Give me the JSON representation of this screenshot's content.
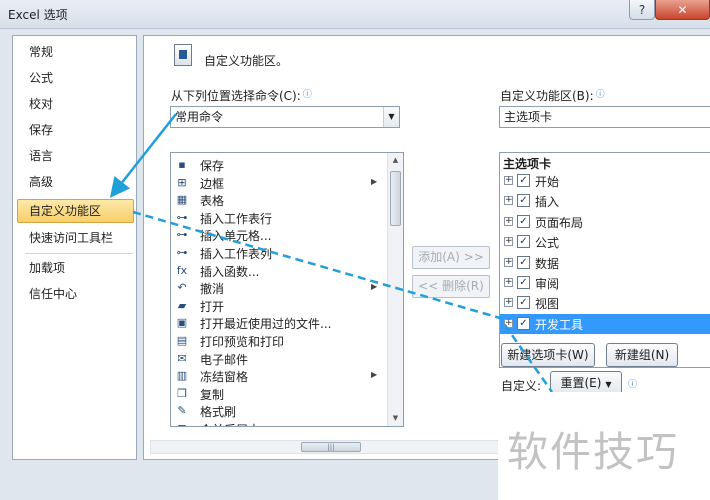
{
  "window": {
    "title": "Excel 选项",
    "help_glyph": "?",
    "close_glyph": "✕"
  },
  "nav": {
    "items": [
      {
        "label": "常规"
      },
      {
        "label": "公式"
      },
      {
        "label": "校对"
      },
      {
        "label": "保存"
      },
      {
        "label": "语言"
      },
      {
        "label": "高级"
      },
      {
        "label": "自定义功能区",
        "active": true
      },
      {
        "label": "快速访问工具栏"
      },
      {
        "label": "加载项"
      },
      {
        "label": "信任中心"
      }
    ]
  },
  "main": {
    "header": {
      "title": "自定义功能区。"
    },
    "choose_commands": {
      "label": "从下列位置选择命令(C):",
      "value": "常用命令"
    },
    "customize_ribbon": {
      "label": "自定义功能区(B):",
      "value": "主选项卡"
    },
    "commands": [
      {
        "label": "保存",
        "icon": "save-icon",
        "glyph": "▪",
        "submenu": false
      },
      {
        "label": "边框",
        "icon": "border-icon",
        "glyph": "⊞",
        "submenu": true
      },
      {
        "label": "表格",
        "icon": "table-icon",
        "glyph": "▦",
        "submenu": false
      },
      {
        "label": "插入工作表行",
        "icon": "insert-row-icon",
        "glyph": "⊶",
        "submenu": false
      },
      {
        "label": "插入单元格...",
        "icon": "insert-cells-icon",
        "glyph": "⊶",
        "submenu": false
      },
      {
        "label": "插入工作表列",
        "icon": "insert-column-icon",
        "glyph": "⊶",
        "submenu": false
      },
      {
        "label": "插入函数...",
        "icon": "function-icon",
        "glyph": "fx",
        "submenu": false
      },
      {
        "label": "撤消",
        "icon": "undo-icon",
        "glyph": "↶",
        "submenu": true
      },
      {
        "label": "打开",
        "icon": "open-folder-icon",
        "glyph": "▰",
        "submenu": false
      },
      {
        "label": "打开最近使用过的文件...",
        "icon": "recent-files-icon",
        "glyph": "▣",
        "submenu": false
      },
      {
        "label": "打印预览和打印",
        "icon": "print-preview-icon",
        "glyph": "▤",
        "submenu": false
      },
      {
        "label": "电子邮件",
        "icon": "email-icon",
        "glyph": "✉",
        "submenu": false
      },
      {
        "label": "冻结窗格",
        "icon": "freeze-panes-icon",
        "glyph": "▥",
        "submenu": true
      },
      {
        "label": "复制",
        "icon": "copy-icon",
        "glyph": "❐",
        "submenu": false
      },
      {
        "label": "格式刷",
        "icon": "format-painter-icon",
        "glyph": "✎",
        "submenu": false
      },
      {
        "label": "合并后居中",
        "icon": "merge-center-icon",
        "glyph": "⊟",
        "submenu": false
      }
    ],
    "add_button": "添加(A) >>",
    "remove_button": "<< 删除(R)",
    "tree": {
      "heading": "主选项卡",
      "tabs": [
        {
          "label": "开始",
          "checked": true
        },
        {
          "label": "插入",
          "checked": true
        },
        {
          "label": "页面布局",
          "checked": true
        },
        {
          "label": "公式",
          "checked": true
        },
        {
          "label": "数据",
          "checked": true
        },
        {
          "label": "审阅",
          "checked": true
        },
        {
          "label": "视图",
          "checked": true
        },
        {
          "label": "开发工具",
          "checked": true,
          "selected": true
        }
      ]
    },
    "new_tab_button": "新建选项卡(W)",
    "new_group_button": "新建组(N)",
    "customizations_label": "自定义:",
    "reset_button": "重置(E)"
  },
  "watermark": "软件技巧",
  "colors": {
    "annotation": "#1fa0da",
    "selection": "#3399ff",
    "nav_highlight": "#f8cf6b"
  }
}
